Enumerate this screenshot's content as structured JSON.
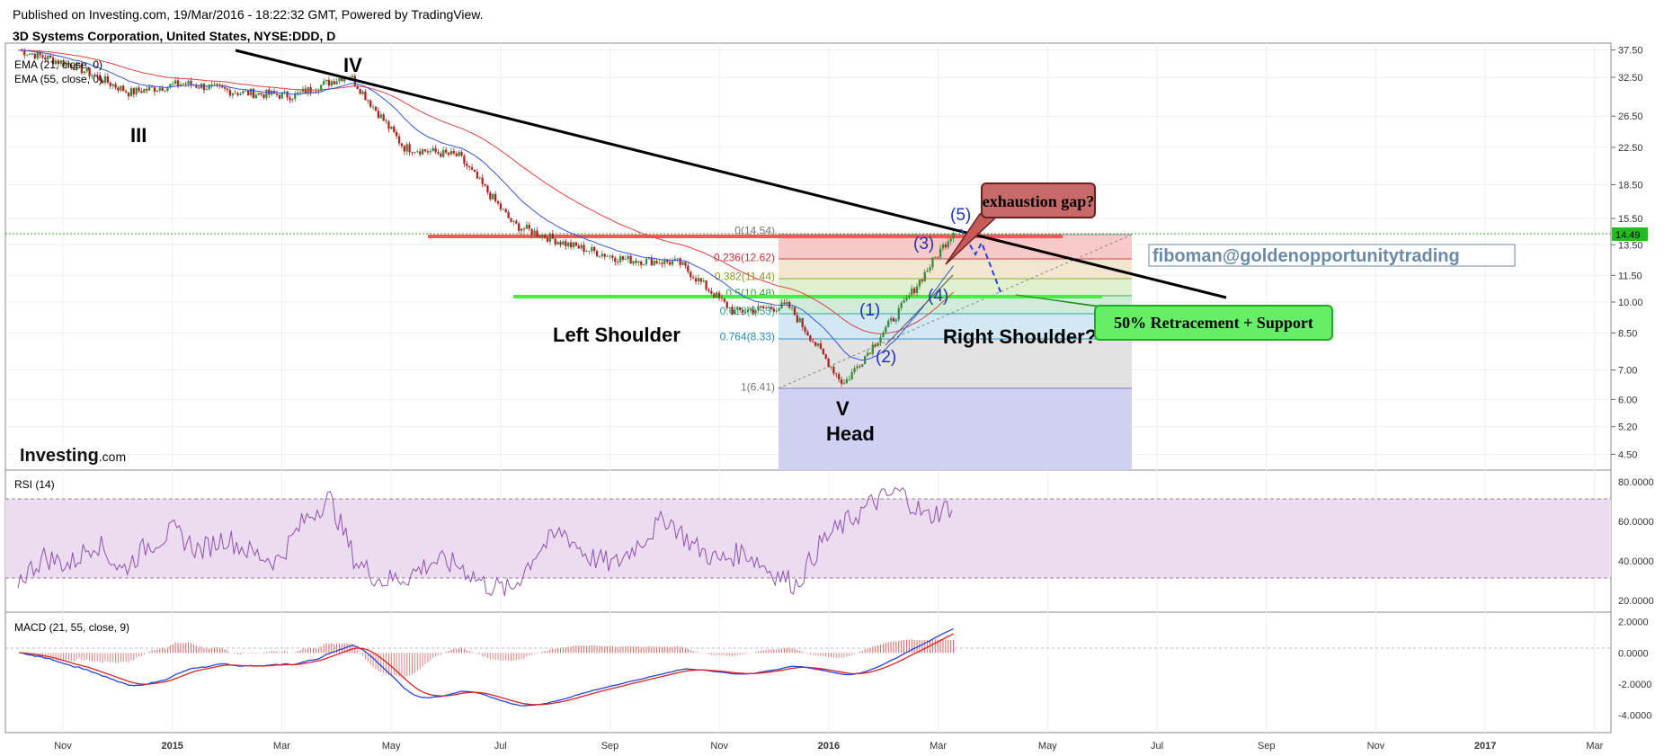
{
  "header": {
    "published": "Published on Investing.com, 19/Mar/2016 - 18:22:32 GMT, Powered by TradingView.",
    "symbol_title": "3D Systems Corporation, United States, NYSE:DDD, D"
  },
  "indicators": {
    "ema21": "EMA (21, close, 0)",
    "ema55": "EMA (55, close, 0)",
    "rsi": "RSI (14)",
    "macd": "MACD (21, 55, close, 9)"
  },
  "branding": {
    "logo_main": "Investing",
    "logo_suffix": ".com"
  },
  "colors": {
    "price_up": "#3a8a3a",
    "price_down": "#b32020",
    "ema21": "#3355dd",
    "ema55": "#e04040",
    "rsi": "#9050b0",
    "rsi_band": "#ecdcf0",
    "current_price_tag": "#22bb22",
    "resistance": "#ff5555",
    "support": "#44ee44",
    "trendline": "#000000"
  },
  "annotations": {
    "wave_III": "III",
    "wave_IV": "IV",
    "wave_V": "V",
    "left_shoulder": "Left Shoulder",
    "head": "Head",
    "right_shoulder": "Right Shoulder?",
    "sub_1": "(1)",
    "sub_2": "(2)",
    "sub_3": "(3)",
    "sub_4": "(4)",
    "sub_5": "(5)",
    "gap_callout": "exhaustion gap?",
    "support_callout": "50% Retracement + Support",
    "author": "fiboman@goldenopportunitytrading"
  },
  "chart_data": [
    {
      "type": "line",
      "panel": "price",
      "y_scale": "log",
      "ylim": [
        4.2,
        38.5
      ],
      "y_ticks": [
        "37.50",
        "32.50",
        "26.50",
        "22.50",
        "18.50",
        "15.50",
        "13.50",
        "11.50",
        "10.00",
        "8.50",
        "7.00",
        "6.00",
        "5.20",
        "4.50"
      ],
      "x_ticks": [
        "Nov",
        "2015",
        "Mar",
        "May",
        "Jul",
        "Sep",
        "Nov",
        "2016",
        "Mar",
        "May",
        "Jul",
        "Sep",
        "Nov",
        "2017",
        "Mar"
      ],
      "last_price": "14.49",
      "series": [
        {
          "x": [
            "2014-10",
            "2014-11",
            "2014-12",
            "2015-01",
            "2015-02",
            "2015-03",
            "2015-04",
            "2015-05",
            "2015-06",
            "2015-07",
            "2015-08",
            "2015-09",
            "2015-10",
            "2015-11",
            "2015-12",
            "2016-01",
            "2016-02",
            "2016-03"
          ],
          "values": [
            37.5,
            34.5,
            30,
            31.5,
            30,
            29.5,
            33,
            22.5,
            21.5,
            15,
            13.5,
            12.5,
            12.3,
            9.5,
            9.8,
            6.5,
            9.5,
            14.5
          ]
        }
      ],
      "fibonacci": [
        {
          "label": "0(14.54)",
          "value": 14.54
        },
        {
          "label": "0.236(12.62)",
          "value": 12.62
        },
        {
          "label": "0.382(11.44)",
          "value": 11.44
        },
        {
          "label": "0.5(10.48)",
          "value": 10.48
        },
        {
          "label": "0.618(9.53)",
          "value": 9.53
        },
        {
          "label": "0.764(8.33)",
          "value": 8.33
        },
        {
          "label": "1(6.41)",
          "value": 6.41
        }
      ]
    },
    {
      "type": "line",
      "panel": "rsi",
      "ylim": [
        15,
        85
      ],
      "y_ticks": [
        "80.0000",
        "60.0000",
        "40.0000",
        "20.0000"
      ],
      "band": [
        30,
        70
      ],
      "series": [
        {
          "values": [
            30,
            42,
            38,
            50,
            35,
            48,
            55,
            45,
            52,
            44,
            40,
            60,
            72,
            40,
            30,
            32,
            40,
            38,
            28,
            25,
            45,
            55,
            42,
            38,
            50,
            62,
            48,
            40,
            45,
            35,
            28,
            50,
            60,
            70,
            75,
            62,
            68
          ]
        }
      ]
    },
    {
      "type": "line",
      "panel": "macd",
      "ylim": [
        -5,
        2.5
      ],
      "y_ticks": [
        "2.0000",
        "0.0000",
        "-2.0000",
        "-4.0000"
      ]
    }
  ]
}
